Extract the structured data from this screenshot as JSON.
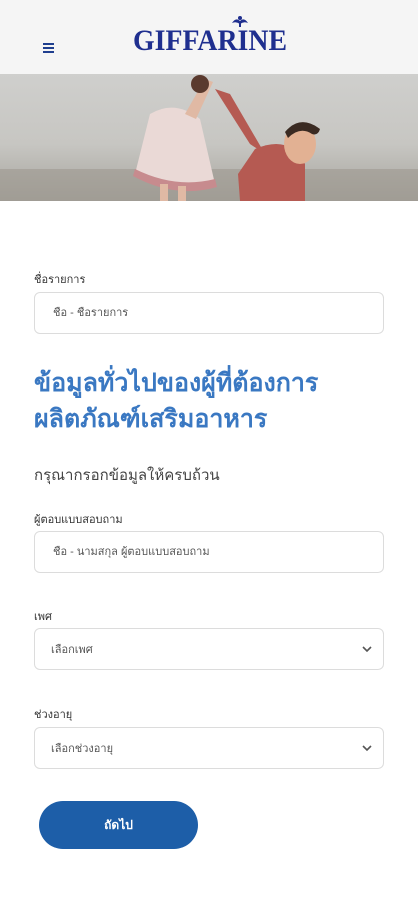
{
  "header": {
    "brand_name": "GIFFARINE",
    "menu_icon": "hamburger-menu-icon",
    "brand_color": "#1f2f8f"
  },
  "hero": {
    "image_description": "photo-banner"
  },
  "form": {
    "item_name": {
      "label": "ชื่อรายการ",
      "placeholder": "ชื่อ - ชื่อรายการ"
    },
    "heading_line1": "ข้อมูลทั่วไปของผู้ที่ต้องการ",
    "heading_line2": "ผลิตภัณฑ์เสริมอาหาร",
    "instruction": "กรุณากรอกข้อมูลให้ครบถ้วน",
    "respondent": {
      "label": "ผู้ตอบแบบสอบถาม",
      "placeholder": "ชื่อ - นามสกุล ผู้ตอบแบบสอบถาม"
    },
    "gender": {
      "label": "เพศ",
      "selected": "เลือกเพศ"
    },
    "age_range": {
      "label": "ช่วงอายุ",
      "selected": "เลือกช่วงอายุ"
    },
    "next_button": "ถัดไป"
  },
  "colors": {
    "accent": "#3a78c2",
    "button": "#1d5ea8",
    "header_bg": "#f5f5f5"
  }
}
